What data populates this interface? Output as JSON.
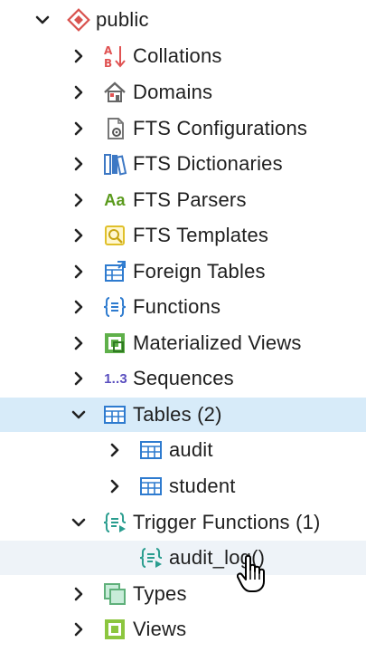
{
  "tree": {
    "schema": {
      "label": "public",
      "icon": "schema-diamond-icon",
      "expanded": true
    },
    "items": [
      {
        "label": "Collations",
        "icon": "collation-az-icon",
        "expanded": false
      },
      {
        "label": "Domains",
        "icon": "domain-house-icon",
        "expanded": false
      },
      {
        "label": "FTS Configurations",
        "icon": "fts-configuration-icon",
        "expanded": false
      },
      {
        "label": "FTS Dictionaries",
        "icon": "fts-dictionary-books-icon",
        "expanded": false
      },
      {
        "label": "FTS Parsers",
        "icon": "fts-parser-aa-icon",
        "icon_text": "Aa",
        "expanded": false
      },
      {
        "label": "FTS Templates",
        "icon": "fts-template-icon",
        "expanded": false
      },
      {
        "label": "Foreign Tables",
        "icon": "foreign-table-icon",
        "expanded": false
      },
      {
        "label": "Functions",
        "icon": "function-braces-icon",
        "expanded": false
      },
      {
        "label": "Materialized Views",
        "icon": "materialized-view-icon",
        "expanded": false
      },
      {
        "label": "Sequences",
        "icon": "sequence-icon",
        "icon_text": "1..3",
        "expanded": false
      },
      {
        "label": "Tables (2)",
        "icon": "tables-grid-icon",
        "expanded": true,
        "selected": true
      },
      {
        "label": "audit",
        "icon": "table-grid-icon",
        "expanded": false
      },
      {
        "label": "student",
        "icon": "table-grid-icon",
        "expanded": false
      },
      {
        "label": "Trigger Functions (1)",
        "icon": "trigger-function-icon",
        "expanded": true
      },
      {
        "label": "audit_log()",
        "icon": "trigger-function-icon",
        "leaf": true,
        "hovered": true
      },
      {
        "label": "Types",
        "icon": "type-icon",
        "expanded": false
      },
      {
        "label": "Views",
        "icon": "view-icon",
        "expanded": false
      }
    ]
  },
  "colors": {
    "selected_row": "#d7ebf9",
    "hover_row": "#eef3f8",
    "collation_red": "#e05252",
    "domain_gray": "#6a6a6a",
    "fts_blue": "#3d78c4",
    "fts_green": "#5a9a1c",
    "fts_yellow": "#e0c02a",
    "table_blue": "#2e7bcf",
    "matview_green": "#5fb04a",
    "sequence_purple": "#5a4fbf"
  },
  "cursor": "hand-pointer-icon"
}
